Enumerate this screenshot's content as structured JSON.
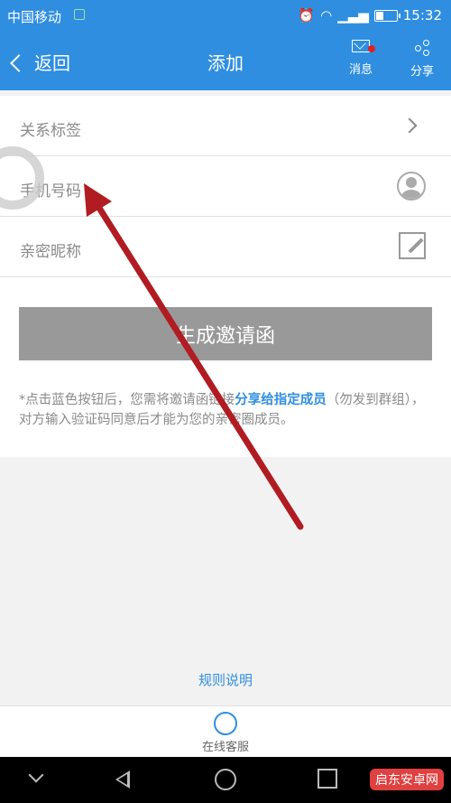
{
  "status": {
    "carrier": "中国移动",
    "time": "15:32"
  },
  "nav": {
    "back_label": "返回",
    "title": "添加",
    "messages_label": "消息",
    "share_label": "分享"
  },
  "form": {
    "rows": [
      {
        "label": "关系标签"
      },
      {
        "label": "手机号码"
      },
      {
        "label": "亲密昵称"
      }
    ]
  },
  "cta": {
    "label": "生成邀请函"
  },
  "note": {
    "before": "*点击蓝色按钮后，您需将邀请函链接",
    "highlight": "分享给指定成员",
    "after": "（勿发到群组），对方输入验证码同意后才能为您的亲密圈成员。"
  },
  "rules": {
    "label": "规则说明"
  },
  "bottombar": {
    "service_label": "在线客服"
  },
  "watermark": {
    "text": "启东安卓网"
  },
  "colors": {
    "primary": "#2f8ee0",
    "button_bg": "#999999",
    "arrow": "#b01c22",
    "dot": "#e02020"
  }
}
